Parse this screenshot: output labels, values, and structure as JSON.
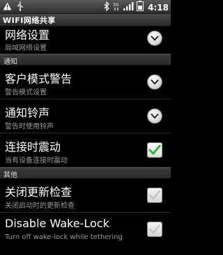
{
  "status_bar": {
    "time": "4:18",
    "icons": [
      "warning-icon",
      "usb-icon",
      "bluetooth-icon",
      "data-3g-icon",
      "signal-icon",
      "battery-icon"
    ]
  },
  "app": {
    "title": "WIFI网络共享"
  },
  "sections": {
    "top_partial": {
      "title": "网络设置",
      "summary": "局域网络设置"
    },
    "notify_header": "通知",
    "other_header": "其他"
  },
  "items": {
    "client_warning": {
      "title": "客户模式警告",
      "summary": "警告模式设置",
      "control": "dropdown"
    },
    "ringtone": {
      "title": "通知铃声",
      "summary": "警告时使用铃声",
      "control": "dropdown"
    },
    "vibrate": {
      "title": "连接时震动",
      "summary": "当有设备连接时震动",
      "checked": true
    },
    "update_check": {
      "title": "关闭更新检查",
      "summary": "关闭启动时的更新检查",
      "checked": false
    },
    "wakelock": {
      "title": "Disable Wake-Lock",
      "summary": "Turn off wake-lock while tethering",
      "checked": false
    }
  },
  "colors": {
    "check_green": "#3fb33f",
    "summary_gray": "#9a9a9a"
  }
}
